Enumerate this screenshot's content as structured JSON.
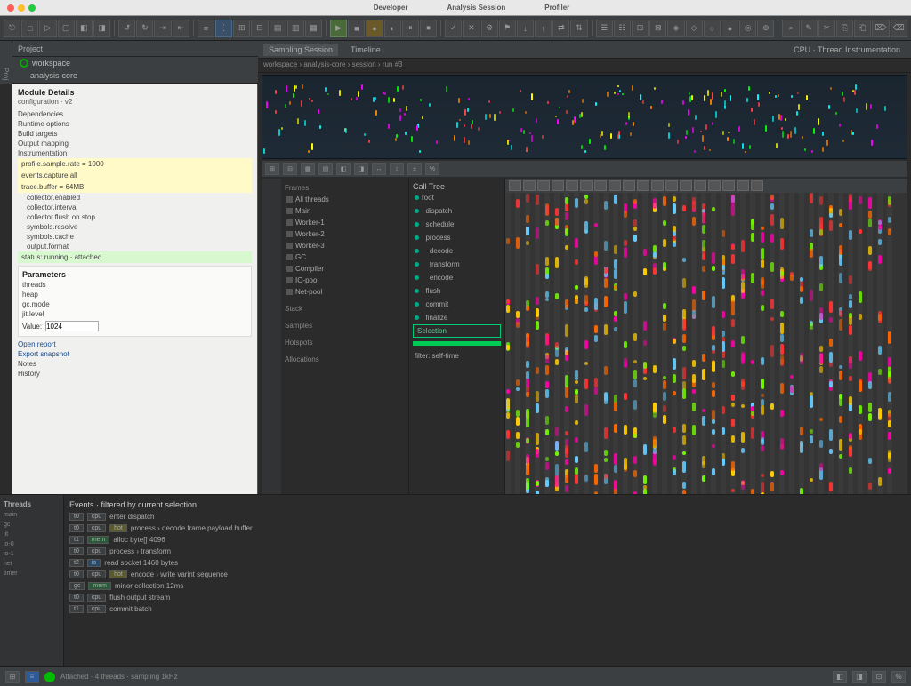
{
  "titlebar": {
    "app": "Developer",
    "center": "Analysis Session",
    "right": "Profiler"
  },
  "toolbar": {
    "groups": [
      {
        "items": [
          "⎋",
          "□",
          "▷",
          "▢",
          "◧",
          "◨"
        ]
      },
      {
        "items": [
          "↺",
          "↻",
          "⇥",
          "⇤"
        ]
      },
      {
        "items": [
          "≡",
          "⋮",
          "⊞",
          "⊟",
          "▤",
          "▥",
          "▦"
        ]
      },
      {
        "items": [
          "▶",
          "■",
          "●",
          "◐",
          "⏸",
          "⏹"
        ]
      },
      {
        "items": [
          "✓",
          "✕",
          "⚙",
          "⚑",
          "↓",
          "↑",
          "⇄",
          "⇅"
        ]
      },
      {
        "items": [
          "☰",
          "☷",
          "⊡",
          "⊠",
          "◈",
          "◇",
          "○",
          "●",
          "◎",
          "⊕"
        ]
      },
      {
        "items": [
          "⌕",
          "✎",
          "✂",
          "⎘",
          "⎗",
          "⌦",
          "⌫"
        ]
      }
    ]
  },
  "sidebar": {
    "header": "Project",
    "root": "workspace",
    "module": "analysis-core"
  },
  "doc": {
    "title": "Module Details",
    "subtitle": "configuration · v2",
    "sections": [
      "Dependencies",
      "Runtime options",
      "Build targets",
      "Output mapping",
      "Instrumentation"
    ],
    "hl_yellow": [
      "profile.sample.rate = 1000",
      "events.capture.all",
      "trace.buffer = 64MB"
    ],
    "config_rows": [
      "collector.enabled",
      "collector.interval",
      "collector.flush.on.stop",
      "symbols.resolve",
      "symbols.cache",
      "output.format"
    ],
    "hl_green": "status: running · attached",
    "inset_title": "Parameters",
    "inset_rows": [
      "threads",
      "heap",
      "gc.mode",
      "jit.level"
    ],
    "entry_label": "Value:",
    "entry_value": "1024",
    "links": [
      "Open report",
      "Export snapshot"
    ],
    "more": [
      "Notes",
      "History"
    ]
  },
  "tabs": {
    "left": "Sampling Session",
    "mid": "Timeline",
    "right": "CPU · Thread Instrumentation",
    "breadcrumb": "workspace › analysis-core › session › run #3"
  },
  "timeline_tools": [
    "⊞",
    "⊟",
    "▦",
    "▤",
    "◧",
    "◨",
    "↔",
    "↕",
    "±",
    "%"
  ],
  "inspector": {
    "header": "Frames",
    "items": [
      "All threads",
      "Main",
      "Worker-1",
      "Worker-2",
      "Worker-3",
      "GC",
      "Compiler",
      "IO-pool",
      "Net-pool"
    ],
    "sections": [
      "Stack",
      "Samples",
      "Hotspots",
      "Allocations"
    ]
  },
  "treepanel": {
    "header": "Call Tree",
    "rows": [
      "root",
      "  dispatch",
      "  schedule",
      "  process",
      "    decode",
      "    transform",
      "    encode",
      "  flush",
      "  commit",
      "  finalize"
    ],
    "box": "Selection",
    "box2": "filter: self-time"
  },
  "viz": {
    "header_btns": [
      "□",
      "▭",
      "▬",
      "▮",
      "▯",
      "▰",
      "▱",
      "◧",
      "◨",
      "◩",
      "◪",
      "☐",
      "☑",
      "☒",
      "⊡",
      "⊠",
      "⊞",
      "⊟"
    ]
  },
  "bottom": {
    "left_header": "Threads",
    "left_rows": [
      "main",
      "gc",
      "jit",
      "io-0",
      "io-1",
      "net",
      "timer"
    ],
    "main_header": "Events · filtered by current selection",
    "rows": [
      {
        "chips": [
          "t0",
          "cpu"
        ],
        "text": "enter dispatch"
      },
      {
        "chips": [
          "t0",
          "cpu",
          "hot"
        ],
        "text": "process › decode frame payload buffer"
      },
      {
        "chips": [
          "t1",
          "mem"
        ],
        "text": "alloc byte[] 4096"
      },
      {
        "chips": [
          "t0",
          "cpu"
        ],
        "text": "process › transform"
      },
      {
        "chips": [
          "t2",
          "io"
        ],
        "text": "read socket 1460 bytes"
      },
      {
        "chips": [
          "t0",
          "cpu",
          "hot"
        ],
        "text": "encode › write varint sequence"
      },
      {
        "chips": [
          "gc",
          "mem"
        ],
        "text": "minor collection 12ms"
      },
      {
        "chips": [
          "t0",
          "cpu"
        ],
        "text": "flush output stream"
      },
      {
        "chips": [
          "t1",
          "cpu"
        ],
        "text": "commit batch"
      }
    ]
  },
  "status": {
    "left": [
      "⊞",
      "≡",
      "▶"
    ],
    "text": "Attached · 4 threads · sampling 1kHz",
    "right": [
      "◧",
      "◨",
      "⊡",
      "%"
    ]
  }
}
